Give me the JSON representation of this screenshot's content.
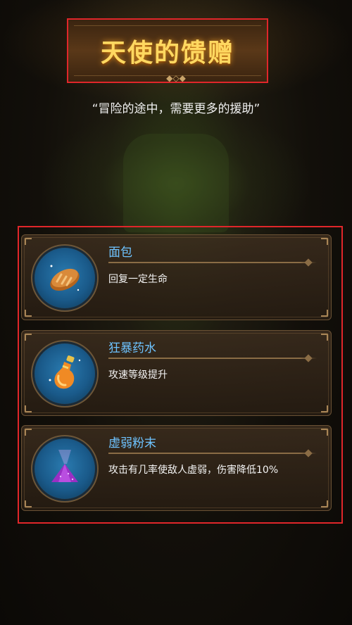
{
  "header": {
    "title": "天使的馈赠",
    "subtitle": "“冒险的途中，需要更多的援助”"
  },
  "items": [
    {
      "name": "面包",
      "description": "回复一定生命",
      "icon": "bread-icon"
    },
    {
      "name": "狂暴药水",
      "description": "攻速等级提升",
      "icon": "potion-icon"
    },
    {
      "name": "虚弱粉末",
      "description": "攻击有几率使敌人虚弱，伤害降低10%",
      "icon": "powder-icon"
    }
  ],
  "colors": {
    "title": "#ffd860",
    "item_name": "#6ec3ff",
    "highlight_frame": "#e0262a"
  }
}
